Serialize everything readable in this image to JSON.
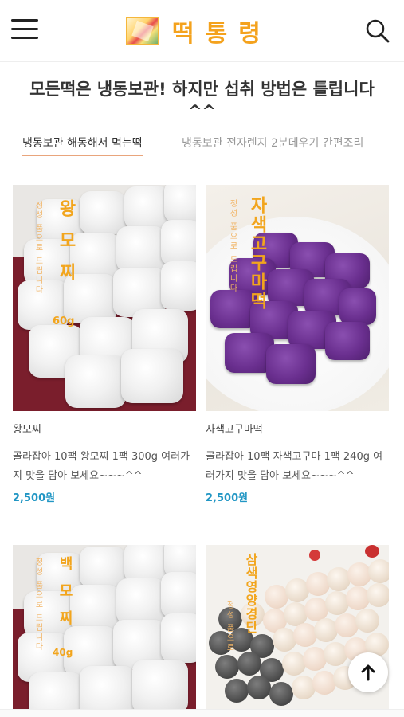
{
  "header": {
    "logo_text": "떡통령",
    "menu_icon": "hamburger-menu-icon",
    "search_icon": "search-icon"
  },
  "headline": "모든떡은 냉동보관! 하지만 섭취 방법은 틀립니다 ^^",
  "tabs": [
    {
      "label": "냉동보관 해동해서 먹는떡",
      "active": true
    },
    {
      "label": "냉동보관 전자렌지 2분데우기 간편조리",
      "active": false
    }
  ],
  "products": [
    {
      "name": "왕모찌",
      "desc": "골라잡아 10팩 왕모찌 1팩 300g 여러가지 맛을 담아 보세요~~~^^",
      "price": "2,500원",
      "image_text": "왕모찌",
      "image_weight": "60g",
      "image_small": "정성 품으로 드립니다"
    },
    {
      "name": "자색고구마떡",
      "desc": "골라잡아 10팩 자색고구마 1팩 240g 여러가지 맛을 담아 보세요~~~^^",
      "price": "2,500원",
      "image_text": "자색고구마떡",
      "image_small": "정성 품으로 드립니다"
    },
    {
      "name": "",
      "desc": "",
      "price": "",
      "image_text": "백모찌",
      "image_weight": "40g",
      "image_small": "정성 품으로 드립니다"
    },
    {
      "name": "",
      "desc": "",
      "price": "",
      "image_text": "삼색영양경단",
      "image_small": "정성 품으로"
    }
  ],
  "scroll_top_icon": "arrow-up-icon",
  "colors": {
    "logo": "#f4a21d",
    "price": "#2196c4",
    "tab_underline": "#e9a57c"
  }
}
